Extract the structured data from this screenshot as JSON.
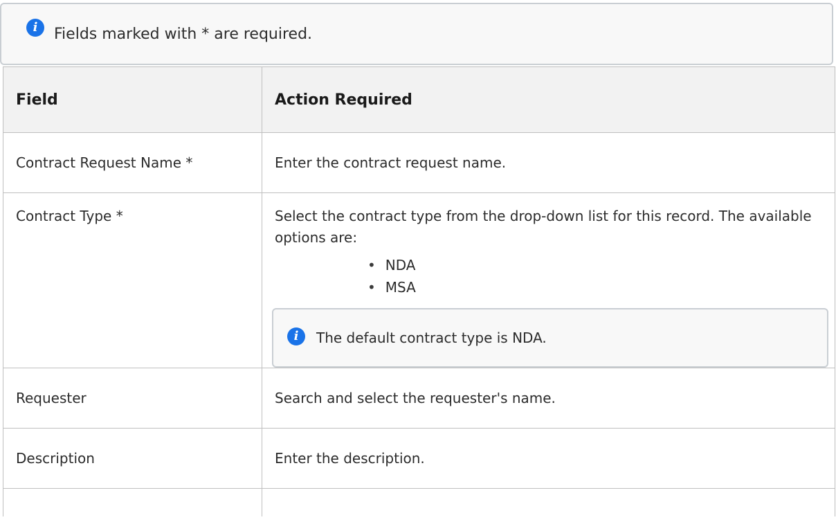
{
  "note": {
    "icon": "info-icon",
    "text": "Fields marked with * are required."
  },
  "table": {
    "headers": [
      "Field",
      "Action Required"
    ],
    "rows": [
      {
        "field": "Contract Request Name *",
        "action": "Enter the contract request name."
      },
      {
        "field": "Contract Type *",
        "action": "Select the contract type from the drop-down list for this record. The available options are:",
        "options": [
          "NDA",
          "MSA"
        ],
        "note": "The default contract type is NDA."
      },
      {
        "field": "Requester",
        "action": "Search and select the requester's name."
      },
      {
        "field": "Description",
        "action": "Enter the description."
      }
    ]
  },
  "colors": {
    "info_icon": "#1a73e8",
    "header_bg": "#f2f2f2",
    "note_bg": "#f8f8f8",
    "border": "#bfbfbf"
  }
}
